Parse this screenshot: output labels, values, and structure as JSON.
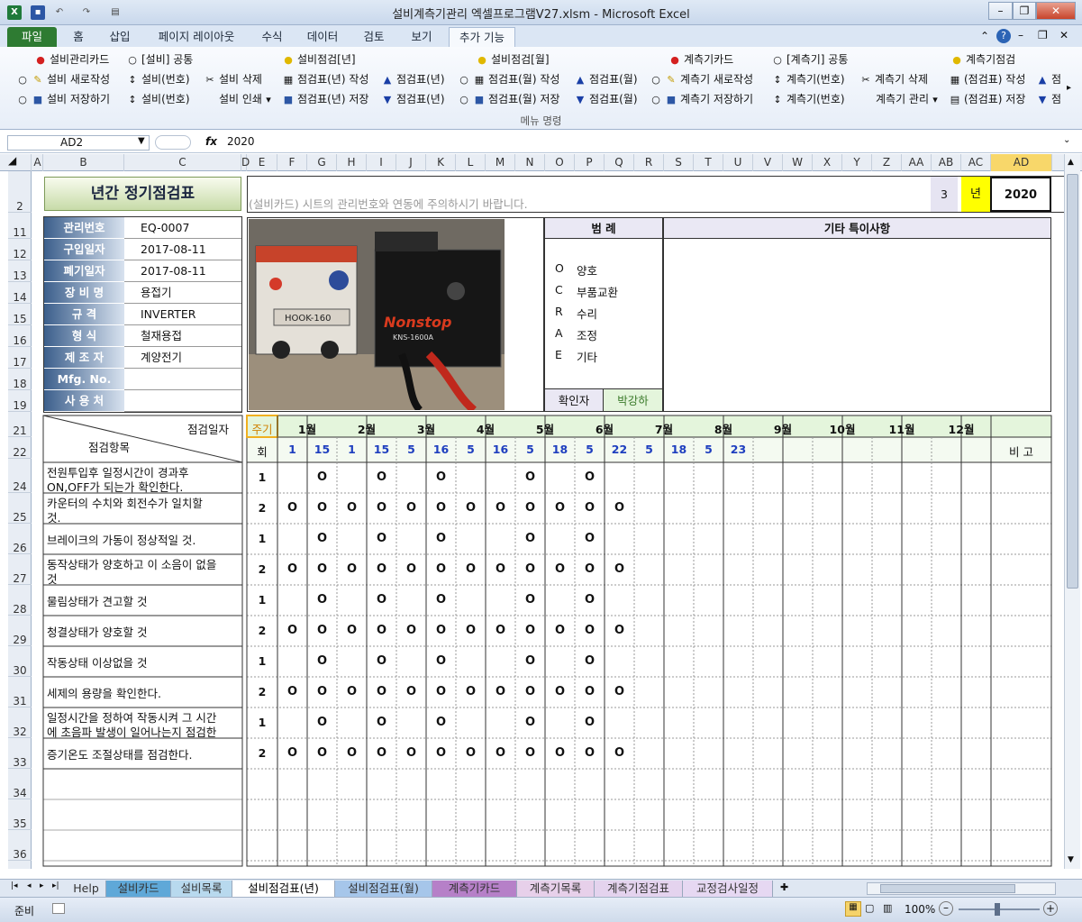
{
  "window": {
    "title": "설비계측기관리 엑셀프로그램V27.xlsm - Microsoft Excel",
    "icon": "excel-icon",
    "controls": [
      "minimize-icon",
      "restore-icon",
      "close-icon"
    ]
  },
  "ribbon": {
    "tabs": [
      "파일",
      "홈",
      "삽입",
      "페이지 레이아웃",
      "수식",
      "데이터",
      "검토",
      "보기",
      "추가 기능"
    ],
    "selected_tab": "추가 기능",
    "rows": [
      [
        "설비관리카드",
        "[설비] 공통",
        "설비점검[년]",
        "설비점검[월]",
        "계측기카드",
        "[계측기] 공통",
        "계측기점검"
      ],
      [
        "설비 새로작성",
        "설비(번호)",
        "설비 삭제",
        "점검표(년) 작성",
        "점검표(년)",
        "점검표(월) 작성",
        "점검표(월)",
        "계측기 새로작성",
        "계측기(번호)",
        "계측기 삭제",
        "(점검표) 작성",
        "점"
      ],
      [
        "설비 저장하기",
        "설비(번호)",
        "설비 인쇄",
        "점검표(년) 저장",
        "점검표(년)",
        "점검표(월) 저장",
        "점검표(월)",
        "계측기 저장하기",
        "계측기(번호)",
        "계측기 관리",
        "(점검표) 저장",
        "점"
      ]
    ],
    "group_label": "메뉴 명령"
  },
  "formula_bar": {
    "name_box": "AD2",
    "formula": "2020"
  },
  "columns": [
    "A",
    "B",
    "C",
    "D",
    "E",
    "F",
    "G",
    "H",
    "I",
    "J",
    "K",
    "L",
    "M",
    "N",
    "O",
    "P",
    "Q",
    "R",
    "S",
    "T",
    "U",
    "V",
    "W",
    "X",
    "Y",
    "Z",
    "AA",
    "AB",
    "AC",
    "AD"
  ],
  "rows": [
    "2",
    "11",
    "12",
    "13",
    "14",
    "15",
    "16",
    "17",
    "18",
    "19",
    "21",
    "22",
    "24",
    "25",
    "26",
    "27",
    "28",
    "29",
    "30",
    "31",
    "32",
    "33",
    "34",
    "35",
    "36"
  ],
  "sheet": {
    "title": "년간 정기점검표",
    "notice": "(설비카드) 시트의 관리번호와 연동에 주의하시기 바랍니다.",
    "year_num": "3",
    "year_label": "년",
    "year_value": "2020",
    "info": [
      {
        "label": "관리번호",
        "value": "EQ-0007"
      },
      {
        "label": "구입일자",
        "value": "2017-08-11"
      },
      {
        "label": "폐기일자",
        "value": "2017-08-11"
      },
      {
        "label": "장 비 명",
        "value": "용접기"
      },
      {
        "label": "규      격",
        "value": "INVERTER"
      },
      {
        "label": "형      식",
        "value": "철재용접"
      },
      {
        "label": "제 조 자",
        "value": "계양전기"
      },
      {
        "label": "Mfg. No.",
        "value": ""
      },
      {
        "label": "사 용 처",
        "value": ""
      }
    ],
    "legend_title": "범    례",
    "legend": [
      {
        "code": "O",
        "text": "양호"
      },
      {
        "code": "C",
        "text": "부품교환"
      },
      {
        "code": "R",
        "text": "수리"
      },
      {
        "code": "A",
        "text": "조정"
      },
      {
        "code": "E",
        "text": "기타"
      }
    ],
    "confirm_label": "확인자",
    "confirm_value": "박강하",
    "remarks_title": "기타 특이사항",
    "photo_texts": [
      "HOOK-160",
      "Nonstop",
      "KNS-1600A"
    ],
    "grid_header": {
      "date_label": "점검일자",
      "item_label": "점검항목",
      "cycle_label": "주기",
      "times_label": "회",
      "bigo": "비  고"
    },
    "months": [
      "1월",
      "2월",
      "3월",
      "4월",
      "5월",
      "6월",
      "7월",
      "8월",
      "9월",
      "10월",
      "11월",
      "12월"
    ],
    "days": [
      "1",
      "15",
      "1",
      "15",
      "5",
      "16",
      "5",
      "16",
      "5",
      "18",
      "5",
      "22",
      "5",
      "18",
      "5",
      "23",
      "",
      "",
      "",
      "",
      "",
      "",
      "",
      ""
    ],
    "items": [
      {
        "text": [
          "전원투입후 일정시간이 경과후",
          "ON,OFF가 되는가 확인한다."
        ],
        "cycle": "1",
        "marks": [
          0,
          1,
          0,
          1,
          0,
          1,
          0,
          0,
          1,
          0,
          1,
          0,
          0,
          0,
          0,
          0,
          0,
          0,
          0,
          0,
          0,
          0,
          0,
          0
        ]
      },
      {
        "text": [
          "카운터의 수치와 회전수가 일치할",
          "것."
        ],
        "cycle": "2",
        "marks": [
          1,
          1,
          1,
          1,
          1,
          1,
          1,
          1,
          1,
          1,
          1,
          1,
          0,
          0,
          0,
          0,
          0,
          0,
          0,
          0,
          0,
          0,
          0,
          0
        ]
      },
      {
        "text": [
          "브레이크의 가동이 정상적일 것."
        ],
        "cycle": "1",
        "marks": [
          0,
          1,
          0,
          1,
          0,
          1,
          0,
          0,
          1,
          0,
          1,
          0,
          0,
          0,
          0,
          0,
          0,
          0,
          0,
          0,
          0,
          0,
          0,
          0
        ]
      },
      {
        "text": [
          "동작상태가 양호하고 이 소음이 없을",
          "것"
        ],
        "cycle": "2",
        "marks": [
          1,
          1,
          1,
          1,
          1,
          1,
          1,
          1,
          1,
          1,
          1,
          1,
          0,
          0,
          0,
          0,
          0,
          0,
          0,
          0,
          0,
          0,
          0,
          0
        ]
      },
      {
        "text": [
          "물림상태가 견고할 것"
        ],
        "cycle": "1",
        "marks": [
          0,
          1,
          0,
          1,
          0,
          1,
          0,
          0,
          1,
          0,
          1,
          0,
          0,
          0,
          0,
          0,
          0,
          0,
          0,
          0,
          0,
          0,
          0,
          0
        ]
      },
      {
        "text": [
          "청결상태가 양호할 것"
        ],
        "cycle": "2",
        "marks": [
          1,
          1,
          1,
          1,
          1,
          1,
          1,
          1,
          1,
          1,
          1,
          1,
          0,
          0,
          0,
          0,
          0,
          0,
          0,
          0,
          0,
          0,
          0,
          0
        ]
      },
      {
        "text": [
          "작동상태 이상없을 것"
        ],
        "cycle": "1",
        "marks": [
          0,
          1,
          0,
          1,
          0,
          1,
          0,
          0,
          1,
          0,
          1,
          0,
          0,
          0,
          0,
          0,
          0,
          0,
          0,
          0,
          0,
          0,
          0,
          0
        ]
      },
      {
        "text": [
          "세제의 용량을 확인한다."
        ],
        "cycle": "2",
        "marks": [
          1,
          1,
          1,
          1,
          1,
          1,
          1,
          1,
          1,
          1,
          1,
          1,
          0,
          0,
          0,
          0,
          0,
          0,
          0,
          0,
          0,
          0,
          0,
          0
        ]
      },
      {
        "text": [
          "일정시간을 정하여 작동시켜 그 시간",
          "에 초음파 발생이 일어나는지 점검한"
        ],
        "cycle": "1",
        "marks": [
          0,
          1,
          0,
          1,
          0,
          1,
          0,
          0,
          1,
          0,
          1,
          0,
          0,
          0,
          0,
          0,
          0,
          0,
          0,
          0,
          0,
          0,
          0,
          0
        ]
      },
      {
        "text": [
          "증기온도 조절상태를 점검한다."
        ],
        "cycle": "2",
        "marks": [
          1,
          1,
          1,
          1,
          1,
          1,
          1,
          1,
          1,
          1,
          1,
          1,
          0,
          0,
          0,
          0,
          0,
          0,
          0,
          0,
          0,
          0,
          0,
          0
        ]
      }
    ],
    "mark_symbol": "O"
  },
  "sheet_tabs": [
    "Help",
    "설비카드",
    "설비목록",
    "설비점검표(년)",
    "설비점검표(월)",
    "계측기카드",
    "계측기목록",
    "계측기점검표",
    "교정검사일정"
  ],
  "active_sheet": "설비점검표(년)",
  "status": {
    "ready": "준비",
    "zoom": "100%"
  },
  "colors": {
    "accent": "#2e7b32",
    "header_blue": "#3c5f8c",
    "cycle_green": "#e4f5dc",
    "day_blue": "#1f3fbf",
    "year_yellow": "#ffff00"
  }
}
